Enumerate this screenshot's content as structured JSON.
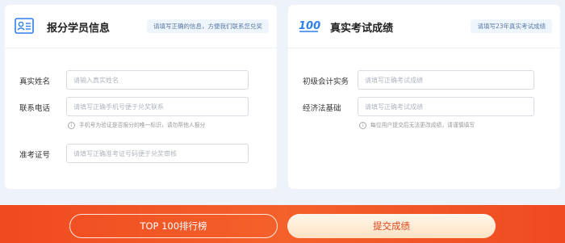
{
  "left_card": {
    "icon": "id-card-icon",
    "title": "报分学员信息",
    "hint": "请填写正确的信息，方便我们联系您兑奖",
    "fields": [
      {
        "label": "真实姓名",
        "placeholder": "请输入真实姓名"
      },
      {
        "label": "联系电话",
        "placeholder": "请填写正确手机号便于兑奖联系",
        "note": "手机号为验证是否报分的唯一标识，请勿帮他人报分"
      },
      {
        "label": "准考证号",
        "placeholder": "请填写正确准考证号码便于兑奖审核"
      }
    ]
  },
  "right_card": {
    "icon_text": "100",
    "title": "真实考试成绩",
    "hint": "请填写23年真实考试成绩",
    "fields": [
      {
        "label": "初级会计实务",
        "placeholder": "请填写正确考试成绩"
      },
      {
        "label": "经济法基础",
        "placeholder": "请填写正确考试成绩",
        "note": "每位用户提交后无法更改成绩，请谨慎填写"
      }
    ]
  },
  "actions": {
    "rank_label": "TOP 100排行榜",
    "submit_label": "提交成绩"
  },
  "colors": {
    "accent_blue": "#2f7ff0",
    "bottom_bar": "#f4612b",
    "submit_text": "#e3461c"
  }
}
